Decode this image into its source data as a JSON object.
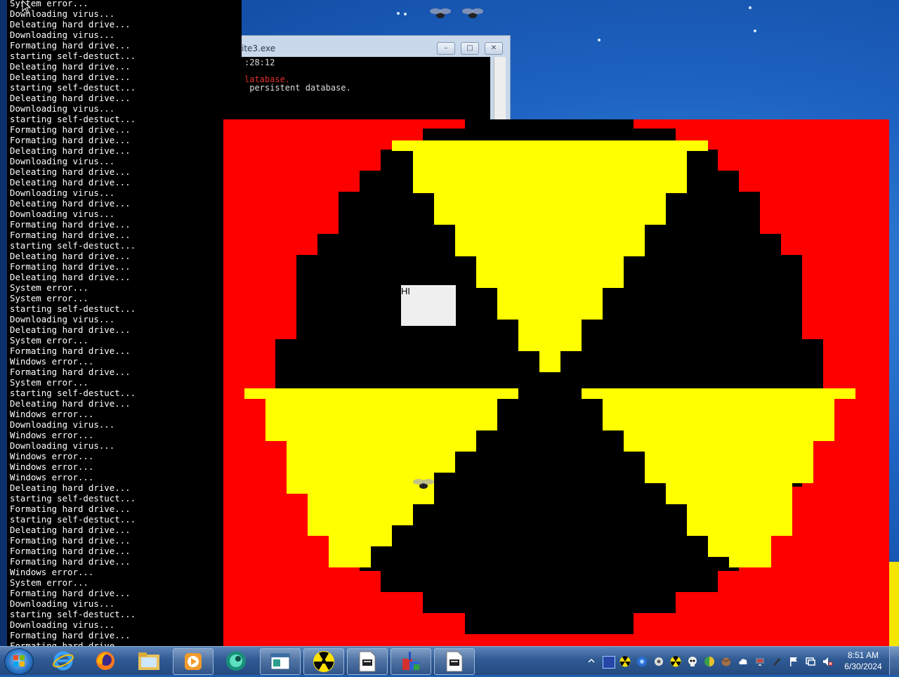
{
  "console": {
    "lines": [
      "System error...",
      "Downloading virus...",
      "Deleating hard drive...",
      "Downloading virus...",
      "Formating hard drive...",
      "starting self-destuct...",
      "Deleating hard drive...",
      "Deleating hard drive...",
      "starting self-destuct...",
      "Deleating hard drive...",
      "Downloading virus...",
      "starting self-destuct...",
      "Formating hard drive...",
      "Formating hard drive...",
      "Deleating hard drive...",
      "Downloading virus...",
      "Deleating hard drive...",
      "Deleating hard drive...",
      "Downloading virus...",
      "Deleating hard drive...",
      "Downloading virus...",
      "Formating hard drive...",
      "Formating hard drive...",
      "starting self-destuct...",
      "Deleating hard drive...",
      "Formating hard drive...",
      "Deleating hard drive...",
      "System error...",
      "System error...",
      "starting self-destuct...",
      "Downloading virus...",
      "Deleating hard drive...",
      "System error...",
      "Formating hard drive...",
      "Windows error...",
      "Formating hard drive...",
      "System error...",
      "starting self-destuct...",
      "Deleating hard drive...",
      "Windows error...",
      "Downloading virus...",
      "Windows error...",
      "Downloading virus...",
      "Windows error...",
      "Windows error...",
      "Windows error...",
      "Deleating hard drive...",
      "starting self-destuct...",
      "Formating hard drive...",
      "starting self-destuct...",
      "Deleating hard drive...",
      "Formating hard drive...",
      "Formating hard drive...",
      "Formating hard drive...",
      "Windows error...",
      "System error...",
      "Formating hard drive...",
      "Downloading virus...",
      "starting self-destuct...",
      "Downloading virus...",
      "Formating hard drive...",
      "Formating hard drive..."
    ]
  },
  "sqlite_window": {
    "title": "ite3.exe",
    "line1": ":28:12",
    "line2": "latabase.",
    "line3": " persistent database.",
    "minimize_glyph": "–",
    "maximize_glyph": "□",
    "close_glyph": "✕"
  },
  "radiation_window": {
    "hi_label": "HI",
    "colors": {
      "background": "#ff0000",
      "circle": "#000000",
      "blades": "#ffff00",
      "box": "#efefef"
    }
  },
  "taskbar": {
    "items": [
      {
        "icon": "internet-explorer-icon"
      },
      {
        "icon": "firefox-icon"
      },
      {
        "icon": "file-explorer-icon"
      },
      {
        "icon": "media-player-icon"
      },
      {
        "icon": "globe-app-icon"
      },
      {
        "icon": "window-app-icon"
      },
      {
        "icon": "radiation-app-icon"
      },
      {
        "icon": "console-app-icon"
      },
      {
        "icon": "installer-app-icon"
      },
      {
        "icon": "console-app-icon-2"
      }
    ],
    "clock_time": "8:51 AM",
    "clock_date": "6/30/2024"
  }
}
